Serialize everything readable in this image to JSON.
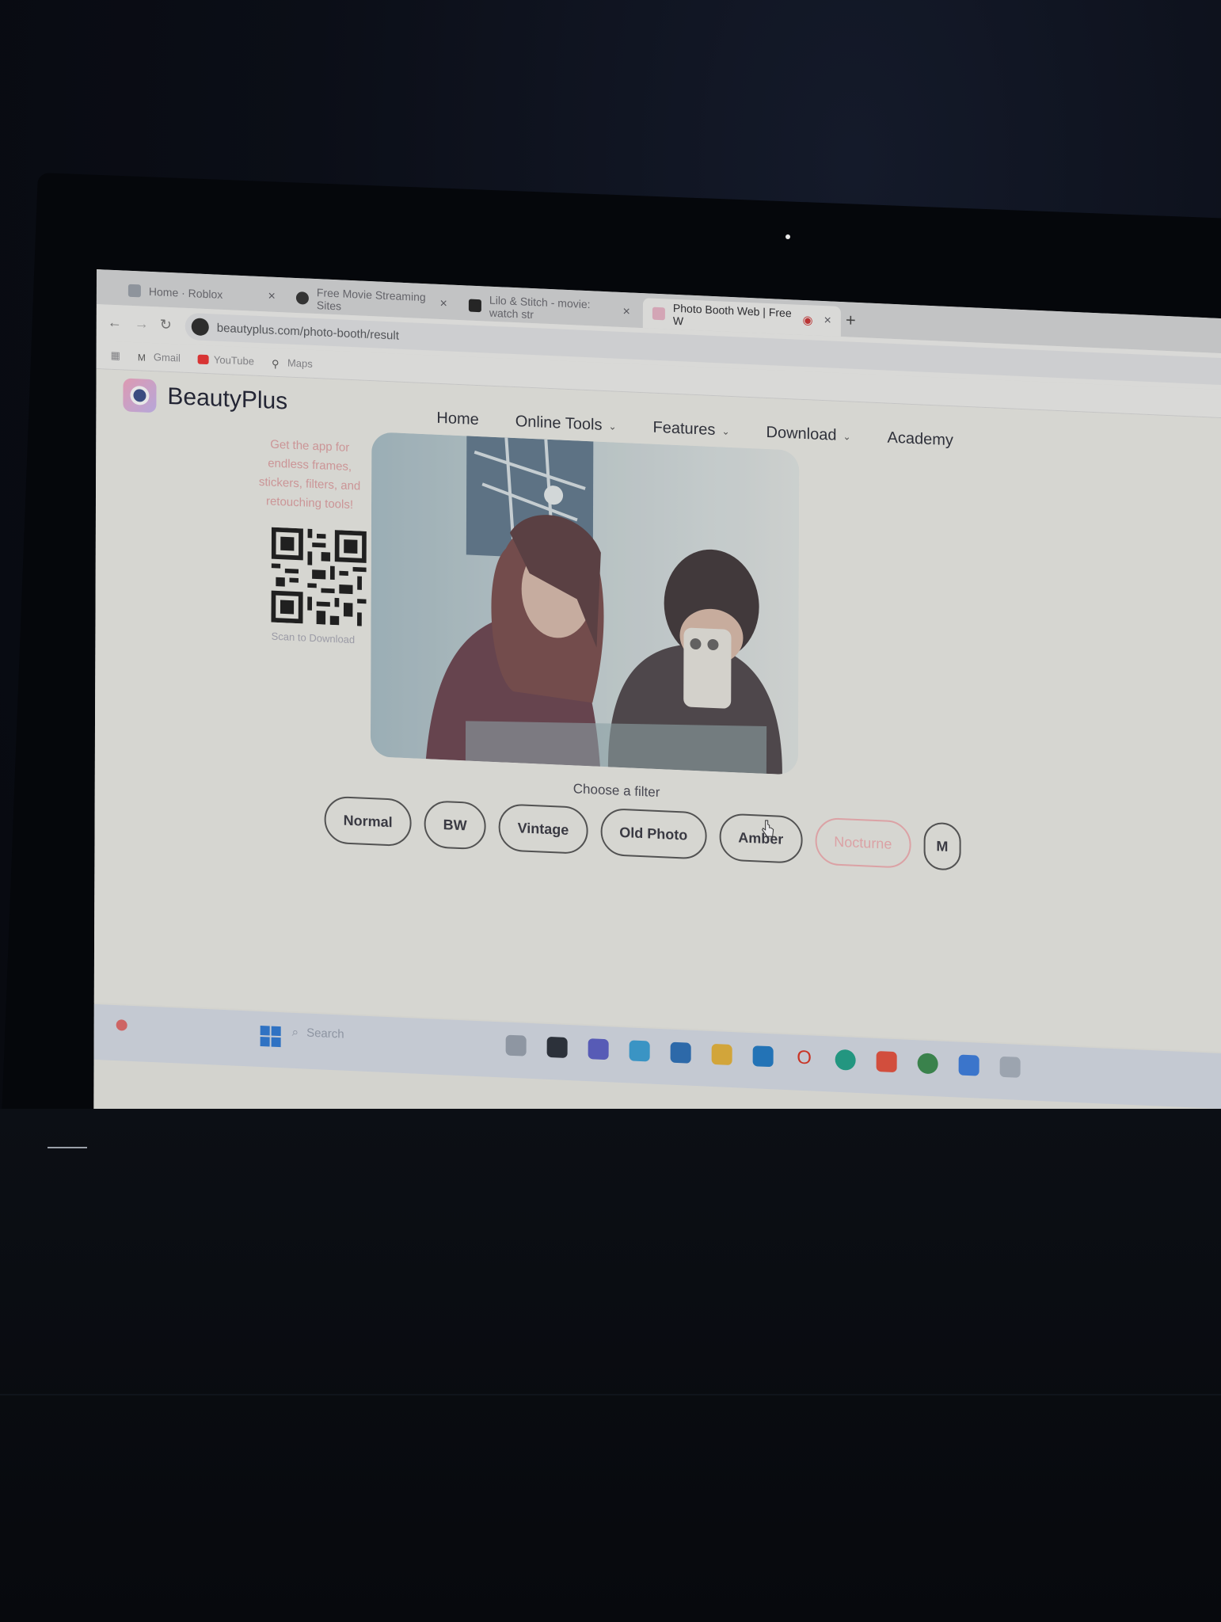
{
  "browser": {
    "tabs": [
      {
        "title": "Home · Roblox",
        "active": false
      },
      {
        "title": "Free Movie Streaming Sites",
        "active": false
      },
      {
        "title": "Lilo & Stitch - movie: watch str",
        "active": false
      },
      {
        "title": "Photo Booth Web | Free W",
        "active": true
      }
    ],
    "url": "beautyplus.com/photo-booth/result",
    "bookmarks": [
      "Gmail",
      "YouTube",
      "Maps"
    ]
  },
  "site": {
    "brand": "BeautyPlus",
    "nav": [
      {
        "label": "Home",
        "dropdown": false
      },
      {
        "label": "Online Tools",
        "dropdown": true
      },
      {
        "label": "Features",
        "dropdown": true
      },
      {
        "label": "Download",
        "dropdown": true
      },
      {
        "label": "Academy",
        "dropdown": false
      }
    ],
    "promo_text": "Get the app for endless frames, stickers, filters, and retouching tools!",
    "qr_caption": "Scan to Download",
    "filter_title": "Choose a filter",
    "filters": [
      {
        "label": "Normal",
        "selected": false
      },
      {
        "label": "BW",
        "selected": false
      },
      {
        "label": "Vintage",
        "selected": false
      },
      {
        "label": "Old Photo",
        "selected": false
      },
      {
        "label": "Amber",
        "selected": false
      },
      {
        "label": "Nocturne",
        "selected": true
      },
      {
        "label": "M",
        "selected": false
      }
    ]
  },
  "taskbar": {
    "search_placeholder": "Search"
  },
  "colors": {
    "accent_pink": "#f2b0b4",
    "page_bg": "#ecece6",
    "taskbar_bg": "#d7dde7",
    "windows_blue": "#2d7ad6"
  }
}
